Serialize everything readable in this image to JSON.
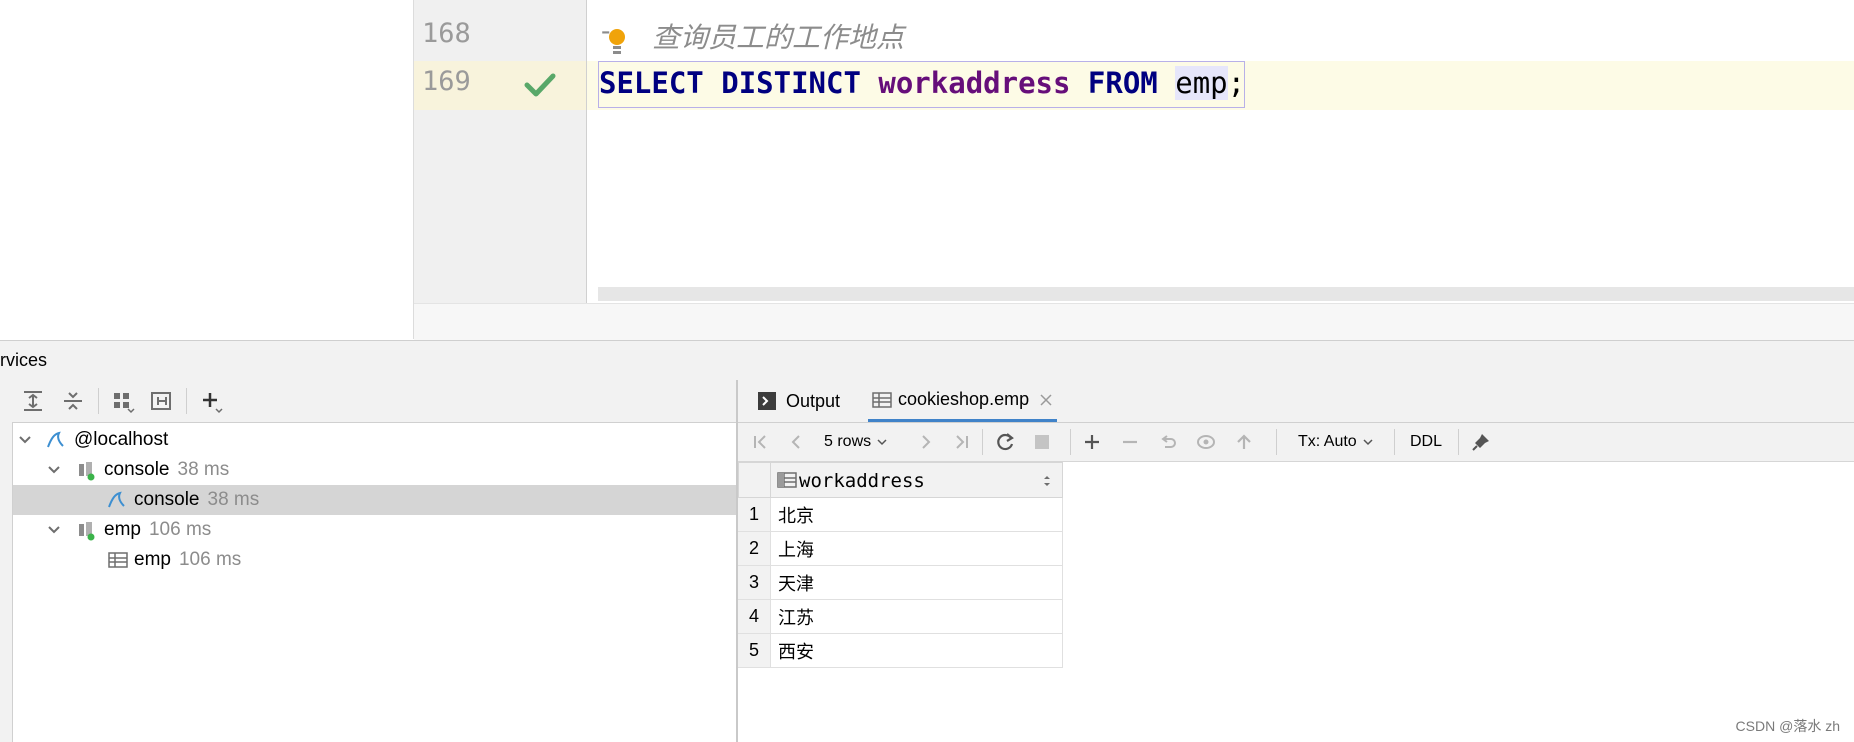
{
  "editor": {
    "lines": [
      {
        "number": "168",
        "comment_prefix": "--",
        "text": "查询员工的工作地点"
      },
      {
        "number": "169",
        "tokens": [
          "SELECT",
          "DISTINCT",
          "workaddress",
          "FROM",
          "emp",
          ";"
        ]
      }
    ]
  },
  "services": {
    "title": "rvices",
    "tree": [
      {
        "label": "@localhost",
        "time": ""
      },
      {
        "label": "console",
        "time": "38 ms"
      },
      {
        "label": "console",
        "time": "38 ms"
      },
      {
        "label": "emp",
        "time": "106 ms"
      },
      {
        "label": "emp",
        "time": "106 ms"
      }
    ]
  },
  "results": {
    "tabs": [
      {
        "label": "Output"
      },
      {
        "label": "cookieshop.emp"
      }
    ],
    "toolbar": {
      "rows_label": "5 rows",
      "tx_label": "Tx: Auto",
      "ddl_label": "DDL"
    },
    "column_header": "workaddress",
    "rows": [
      {
        "n": "1",
        "value": "北京"
      },
      {
        "n": "2",
        "value": "上海"
      },
      {
        "n": "3",
        "value": "天津"
      },
      {
        "n": "4",
        "value": "江苏"
      },
      {
        "n": "5",
        "value": "西安"
      }
    ]
  },
  "watermark": "CSDN @落水 zh",
  "colors": {
    "keyword": "#000080",
    "column": "#660e7a",
    "success_check": "#59a869",
    "active_tab_underline": "#4083c9"
  }
}
